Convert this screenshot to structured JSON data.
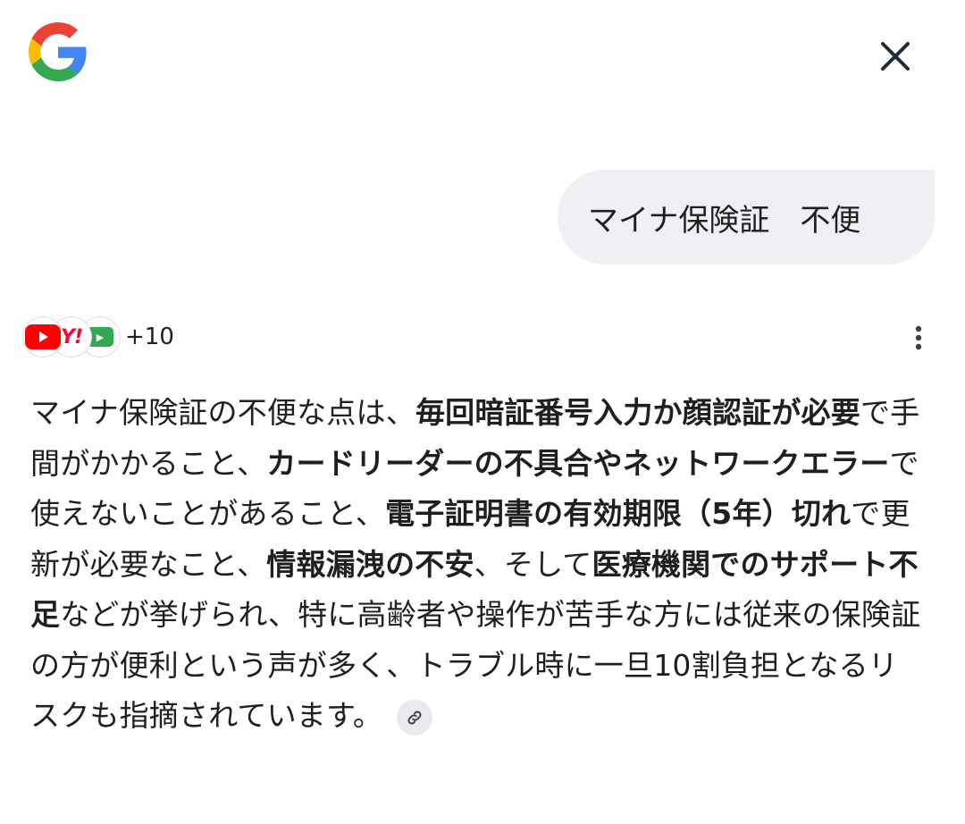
{
  "header": {
    "logo_icon": "google-g-icon",
    "close_icon": "close-icon"
  },
  "query": {
    "text": "マイナ保険証　不便"
  },
  "sources": {
    "favicons": [
      "youtube-icon",
      "yahoo-icon",
      "green-site-icon"
    ],
    "more_count": "+10",
    "menu_icon": "more-vert-icon"
  },
  "answer": {
    "segments": [
      {
        "text": "マイナ保険証の不便な点は、",
        "bold": false
      },
      {
        "text": "毎回暗証番号入力か顔認証が必要",
        "bold": true
      },
      {
        "text": "で手間がかかること、",
        "bold": false
      },
      {
        "text": "カードリーダーの不具合やネットワークエラー",
        "bold": true
      },
      {
        "text": "で使えないことがあること、",
        "bold": false
      },
      {
        "text": "電子証明書の有効期限（5年）切れ",
        "bold": true
      },
      {
        "text": "で更新が必要なこと、",
        "bold": false
      },
      {
        "text": "情報漏洩の不安",
        "bold": true
      },
      {
        "text": "、そして",
        "bold": false
      },
      {
        "text": "医療機関でのサポート不足",
        "bold": true
      },
      {
        "text": "などが挙げられ、特に高齢者や操作が苦手な方には従来の保険証の方が便利という声が多く、トラブル時に一旦10割負担となるリスクも指摘されています。",
        "bold": false
      }
    ],
    "link_icon": "link-icon"
  },
  "colors": {
    "bubble_bg": "#eef0f4",
    "text": "#1f1f1f",
    "youtube_red": "#ff0000",
    "yahoo_red": "#ff0033"
  }
}
